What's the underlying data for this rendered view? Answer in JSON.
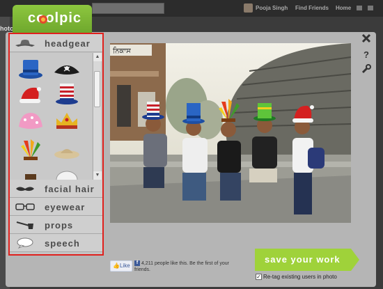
{
  "app": {
    "logo_text": "coolpic"
  },
  "background": {
    "fb_user_name": "Pooja Singh",
    "fb_find_friends": "Find Friends",
    "fb_home": "Home",
    "bg_partial_text": "hoto"
  },
  "sidebar": {
    "categories": [
      {
        "label": "headgear",
        "icon": "hat-icon"
      },
      {
        "label": "facial hair",
        "icon": "mustache-icon"
      },
      {
        "label": "eyewear",
        "icon": "glasses-icon"
      },
      {
        "label": "props",
        "icon": "pipe-icon"
      },
      {
        "label": "speech",
        "icon": "speech-bubble-icon"
      }
    ],
    "items": [
      {
        "name": "blue-top-hat-icon"
      },
      {
        "name": "pirate-hat-icon"
      },
      {
        "name": "santa-hat-icon"
      },
      {
        "name": "uncle-sam-hat-icon"
      },
      {
        "name": "pink-shower-cap-icon"
      },
      {
        "name": "crown-icon"
      },
      {
        "name": "feather-headdress-icon"
      },
      {
        "name": "straw-hat-icon"
      }
    ]
  },
  "photo": {
    "sign_text": "ਨਿਕਾਸ"
  },
  "tools": [
    "close-icon",
    "help-icon",
    "settings-icon"
  ],
  "social": {
    "like_label": "Like",
    "like_count_text": "4,211 people like this. Be the first of your friends."
  },
  "actions": {
    "save_label": "save your work",
    "retag_label": "Re-tag existing users in photo",
    "retag_checked": "✓"
  },
  "colors": {
    "brand_green": "#8dc63f",
    "highlight_red": "#e0201c"
  }
}
